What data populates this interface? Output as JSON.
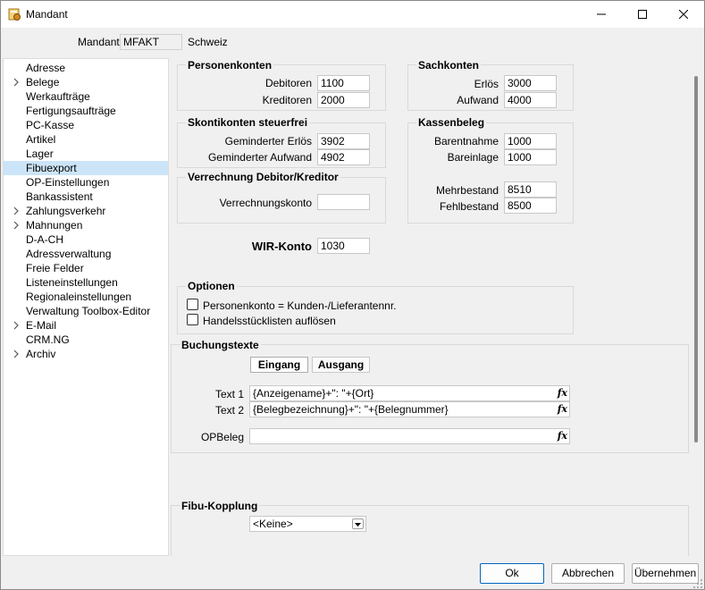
{
  "window": {
    "title": "Mandant"
  },
  "header": {
    "mandant_label": "Mandant",
    "mandant_value": "MFAKT",
    "mandant_name": "Schweiz"
  },
  "sidebar": {
    "items": [
      {
        "label": "Adresse",
        "expandable": false
      },
      {
        "label": "Belege",
        "expandable": true
      },
      {
        "label": "Werkaufträge",
        "expandable": false
      },
      {
        "label": "Fertigungsaufträge",
        "expandable": false
      },
      {
        "label": "PC-Kasse",
        "expandable": false
      },
      {
        "label": "Artikel",
        "expandable": false
      },
      {
        "label": "Lager",
        "expandable": false
      },
      {
        "label": "Fibuexport",
        "expandable": false,
        "selected": true
      },
      {
        "label": "OP-Einstellungen",
        "expandable": false
      },
      {
        "label": "Bankassistent",
        "expandable": false
      },
      {
        "label": "Zahlungsverkehr",
        "expandable": true
      },
      {
        "label": "Mahnungen",
        "expandable": true
      },
      {
        "label": "D-A-CH",
        "expandable": false
      },
      {
        "label": "Adressverwaltung",
        "expandable": false
      },
      {
        "label": "Freie Felder",
        "expandable": false
      },
      {
        "label": "Listeneinstellungen",
        "expandable": false
      },
      {
        "label": "Regionaleinstellungen",
        "expandable": false
      },
      {
        "label": "Verwaltung Toolbox-Editor",
        "expandable": false
      },
      {
        "label": "E-Mail",
        "expandable": true
      },
      {
        "label": "CRM.NG",
        "expandable": false
      },
      {
        "label": "Archiv",
        "expandable": true
      }
    ]
  },
  "personenkonten": {
    "title": "Personenkonten",
    "debitoren_label": "Debitoren",
    "debitoren_value": "1100",
    "kreditoren_label": "Kreditoren",
    "kreditoren_value": "2000"
  },
  "sachkonten": {
    "title": "Sachkonten",
    "erloes_label": "Erlös",
    "erloes_value": "3000",
    "aufwand_label": "Aufwand",
    "aufwand_value": "4000"
  },
  "skontokonten": {
    "title": "Skontikonten steuerfrei",
    "erloes_label": "Geminderter Erlös",
    "erloes_value": "3902",
    "aufwand_label": "Geminderter Aufwand",
    "aufwand_value": "4902"
  },
  "kassenbeleg": {
    "title": "Kassenbeleg",
    "barentnahme_label": "Barentnahme",
    "barentnahme_value": "1000",
    "bareinlage_label": "Bareinlage",
    "bareinlage_value": "1000",
    "mehrbestand_label": "Mehrbestand",
    "mehrbestand_value": "8510",
    "fehlbestand_label": "Fehlbestand",
    "fehlbestand_value": "8500"
  },
  "verrechnung": {
    "title": "Verrechnung Debitor/Kreditor",
    "konto_label": "Verrechnungskonto",
    "konto_value": ""
  },
  "wir": {
    "label": "WIR-Konto",
    "value": "1030"
  },
  "optionen": {
    "title": "Optionen",
    "option1_label": "Personenkonto = Kunden-/Lieferantennr.",
    "option1_checked": false,
    "option2_label": "Handelsstücklisten auflösen",
    "option2_checked": false
  },
  "buchungstexte": {
    "title": "Buchungstexte",
    "tab_eingang": "Eingang",
    "tab_ausgang": "Ausgang",
    "text1_label": "Text 1",
    "text1_value": "{Anzeigename}+\": \"+{Ort}",
    "text2_label": "Text 2",
    "text2_value": "{Belegbezeichnung}+\": \"+{Belegnummer}",
    "opbeleg_label": "OPBeleg",
    "opbeleg_value": "",
    "fx_label": "fx"
  },
  "fibu": {
    "title": "Fibu-Kopplung",
    "select_value": "<Keine>"
  },
  "footer": {
    "ok_label": "Ok",
    "cancel_label": "Abbrechen",
    "apply_label": "Übernehmen"
  },
  "colors": {
    "selection": "#cce4f7",
    "primary_border": "#0067c0"
  }
}
